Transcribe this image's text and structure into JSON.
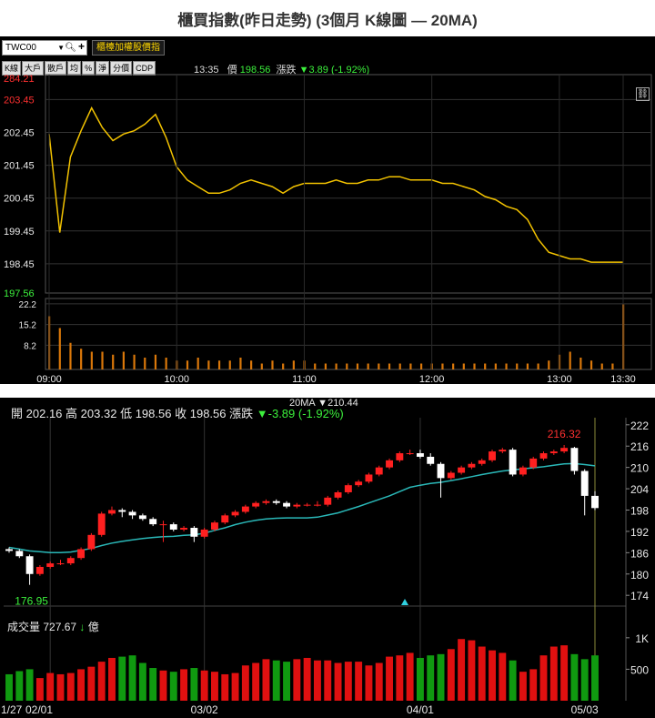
{
  "title": "櫃買指數(昨日走勢) (3個月 K線圖 — 20MA)",
  "top": {
    "code": "TWC00",
    "special_button": "櫃檯加權股價指",
    "tabs": [
      "K線",
      "大戶",
      "散戶",
      "均",
      "%",
      "淨",
      "分價",
      "CDP"
    ],
    "time": "13:35",
    "price_label": "價",
    "price": "198.56",
    "change_label": "漲跌",
    "change": "▼3.89 (-1.92%)",
    "y_labels": [
      "284.21",
      "203.45",
      "202.45",
      "201.45",
      "200.45",
      "199.45",
      "198.45",
      "197.56"
    ],
    "vol_labels": [
      "22.2",
      "15.2",
      "8.2"
    ],
    "x_labels": [
      "09:00",
      "10:00",
      "11:00",
      "12:00",
      "13:00",
      "13:30"
    ]
  },
  "bottom": {
    "ohlc": {
      "open_label": "開",
      "open": "202.16",
      "high_label": "高",
      "high": "203.32",
      "low_label": "低",
      "low": "198.56",
      "close_label": "收",
      "close": "198.56",
      "change_label": "漲跌",
      "change": "▼-3.89 (-1.92%)"
    },
    "ma_legend": "20MA ▼210.44",
    "volume_label": "成交量",
    "volume_value": "727.67",
    "volume_arrow": "↓",
    "volume_unit": "億",
    "y_labels": [
      "222",
      "216",
      "210",
      "204",
      "198",
      "192",
      "186",
      "180",
      "174"
    ],
    "vol_y_labels": [
      "1K",
      "500"
    ],
    "x_labels": [
      "1/27",
      "02/01",
      "03/02",
      "04/01",
      "05/03"
    ],
    "annot_low": "176.95",
    "annot_high": "216.32"
  },
  "colors": {
    "up": "#ff2020",
    "down": "#ffffff",
    "ma": "#2ab8b8",
    "line": "#f2c200",
    "volbar": "#d9770a",
    "vol_up": "#e01010",
    "vol_down": "#109a10"
  },
  "chart_data": [
    {
      "type": "line",
      "x": [
        "09:00",
        "09:05",
        "09:10",
        "09:15",
        "09:20",
        "09:25",
        "09:30",
        "09:35",
        "09:40",
        "09:45",
        "09:50",
        "09:55",
        "10:00",
        "10:05",
        "10:10",
        "10:15",
        "10:20",
        "10:25",
        "10:30",
        "10:35",
        "10:40",
        "10:45",
        "10:50",
        "10:55",
        "11:00",
        "11:05",
        "11:10",
        "11:15",
        "11:20",
        "11:25",
        "11:30",
        "11:35",
        "11:40",
        "11:45",
        "11:50",
        "11:55",
        "12:00",
        "12:05",
        "12:10",
        "12:15",
        "12:20",
        "12:25",
        "12:30",
        "12:35",
        "12:40",
        "12:45",
        "12:50",
        "12:55",
        "13:00",
        "13:05",
        "13:10",
        "13:15",
        "13:20",
        "13:25",
        "13:30"
      ],
      "values": [
        202.4,
        199.4,
        201.7,
        202.5,
        203.2,
        202.6,
        202.2,
        202.4,
        202.5,
        202.7,
        203.0,
        202.3,
        201.4,
        201.0,
        200.8,
        200.6,
        200.6,
        200.7,
        200.9,
        201.0,
        200.9,
        200.8,
        200.6,
        200.8,
        200.9,
        200.9,
        200.9,
        201.0,
        200.9,
        200.9,
        201.0,
        201.0,
        201.1,
        201.1,
        201.0,
        201.0,
        201.0,
        200.9,
        200.9,
        200.8,
        200.7,
        200.5,
        200.4,
        200.2,
        200.1,
        199.8,
        199.2,
        198.8,
        198.7,
        198.6,
        198.6,
        198.5,
        198.5,
        198.5,
        198.5
      ],
      "ylim": [
        197.56,
        204.21
      ],
      "volume": [
        18,
        14,
        9,
        7,
        6,
        6,
        5,
        6,
        5,
        4,
        5,
        4,
        3,
        3,
        4,
        3,
        3,
        3,
        4,
        3,
        2,
        3,
        2,
        3,
        3,
        2,
        2,
        2,
        2,
        2,
        2,
        2,
        2,
        2,
        2,
        2,
        2,
        2,
        2,
        2,
        2,
        2,
        2,
        2,
        2,
        2,
        2,
        3,
        5,
        6,
        4,
        3,
        2,
        2,
        22
      ]
    },
    {
      "type": "candlestick",
      "x": [
        "01/27",
        "01/28",
        "01/29",
        "01/30",
        "02/01",
        "02/02",
        "02/05",
        "02/06",
        "02/07",
        "02/14",
        "02/15",
        "02/16",
        "02/20",
        "02/21",
        "02/22",
        "02/23",
        "02/26",
        "02/27",
        "03/01",
        "03/02",
        "03/05",
        "03/06",
        "03/07",
        "03/08",
        "03/09",
        "03/12",
        "03/13",
        "03/14",
        "03/15",
        "03/16",
        "03/19",
        "03/20",
        "03/21",
        "03/22",
        "03/23",
        "03/26",
        "03/27",
        "03/28",
        "03/29",
        "03/30",
        "04/01",
        "04/02",
        "04/03",
        "04/05",
        "04/06",
        "04/09",
        "04/10",
        "04/11",
        "04/12",
        "04/13",
        "04/16",
        "04/17",
        "04/18",
        "04/19",
        "04/20",
        "04/23",
        "04/24",
        "04/25",
        "04/26",
        "04/29",
        "05/02",
        "05/03"
      ],
      "open": [
        187.0,
        186.5,
        185.0,
        180.0,
        182.0,
        183.0,
        183.0,
        184.5,
        187.0,
        191.0,
        197.0,
        198.0,
        197.5,
        196.5,
        195.5,
        194.0,
        194.0,
        192.5,
        193.0,
        190.5,
        192.5,
        194.5,
        196.5,
        197.5,
        199.0,
        200.0,
        200.5,
        200.0,
        199.0,
        199.5,
        199.5,
        199.5,
        201.5,
        203.0,
        205.0,
        206.0,
        208.0,
        210.0,
        212.0,
        214.0,
        214.0,
        213.0,
        211.0,
        207.0,
        208.5,
        210.0,
        211.0,
        212.0,
        214.5,
        215.0,
        208.0,
        210.0,
        212.5,
        214.0,
        214.5,
        215.5,
        209.0,
        202.0
      ],
      "close": [
        186.5,
        185.0,
        180.0,
        182.0,
        183.0,
        183.0,
        184.5,
        187.0,
        191.0,
        197.0,
        198.0,
        197.5,
        196.5,
        195.5,
        194.0,
        194.0,
        192.5,
        193.0,
        190.5,
        192.5,
        194.5,
        196.5,
        197.5,
        199.0,
        200.0,
        200.5,
        200.0,
        199.0,
        199.5,
        199.5,
        199.5,
        201.5,
        203.0,
        205.0,
        206.0,
        208.0,
        210.0,
        212.0,
        214.0,
        214.0,
        213.0,
        211.0,
        207.0,
        208.5,
        210.0,
        211.0,
        212.0,
        214.5,
        215.0,
        208.0,
        210.0,
        212.5,
        214.0,
        214.5,
        215.5,
        209.0,
        202.0,
        198.56
      ],
      "high": [
        187.5,
        187.0,
        185.5,
        182.5,
        183.5,
        184.0,
        185.0,
        187.5,
        191.5,
        197.5,
        199.0,
        198.5,
        198.0,
        197.0,
        196.0,
        195.0,
        194.5,
        193.5,
        193.5,
        193.0,
        195.0,
        197.0,
        198.0,
        199.5,
        200.5,
        201.0,
        201.0,
        200.5,
        200.0,
        200.0,
        200.5,
        202.0,
        203.5,
        205.5,
        206.5,
        208.5,
        210.5,
        212.5,
        214.5,
        215.0,
        215.0,
        214.0,
        211.5,
        209.0,
        210.5,
        211.5,
        212.5,
        215.0,
        215.5,
        215.5,
        210.5,
        213.0,
        214.5,
        215.0,
        216.32,
        215.8,
        209.5,
        203.32
      ],
      "low": [
        186.0,
        184.5,
        176.95,
        179.5,
        181.5,
        182.5,
        182.5,
        184.0,
        186.5,
        190.5,
        196.5,
        196.0,
        195.5,
        195.0,
        193.5,
        189.0,
        192.0,
        192.0,
        189.0,
        190.0,
        192.0,
        194.0,
        196.0,
        197.0,
        198.5,
        199.5,
        199.5,
        198.5,
        198.5,
        199.0,
        199.0,
        199.0,
        201.0,
        202.5,
        204.5,
        205.5,
        207.5,
        209.5,
        211.5,
        213.5,
        212.5,
        210.5,
        201.5,
        206.5,
        208.0,
        209.5,
        210.5,
        211.5,
        214.0,
        207.5,
        207.5,
        209.5,
        212.0,
        213.5,
        214.0,
        208.0,
        196.5,
        198.0
      ],
      "ma20": [
        187.5,
        187.0,
        186.5,
        186.3,
        186.0,
        186.0,
        186.2,
        186.7,
        187.2,
        188.0,
        188.7,
        189.2,
        189.6,
        190.0,
        190.3,
        190.5,
        190.6,
        190.9,
        191.0,
        191.5,
        192.3,
        193.0,
        193.9,
        194.6,
        195.1,
        195.5,
        195.7,
        195.8,
        195.8,
        195.8,
        196.0,
        196.6,
        197.2,
        198.1,
        199.0,
        200.0,
        201.0,
        202.0,
        203.2,
        204.4,
        205.0,
        205.5,
        205.8,
        206.3,
        206.8,
        207.4,
        208.0,
        208.5,
        209.0,
        209.3,
        209.6,
        209.9,
        210.2,
        210.6,
        211.0,
        211.1,
        210.8,
        210.44
      ],
      "volume": [
        420,
        470,
        500,
        360,
        440,
        420,
        440,
        500,
        540,
        620,
        680,
        700,
        720,
        600,
        520,
        480,
        460,
        500,
        520,
        480,
        460,
        420,
        440,
        560,
        600,
        660,
        640,
        620,
        660,
        680,
        640,
        640,
        600,
        620,
        620,
        560,
        600,
        700,
        720,
        760,
        680,
        720,
        740,
        820,
        980,
        960,
        860,
        800,
        760,
        640,
        460,
        500,
        720,
        860,
        880,
        740,
        660,
        720
      ],
      "ylim": [
        172,
        224
      ],
      "ma_name": "20MA"
    }
  ]
}
